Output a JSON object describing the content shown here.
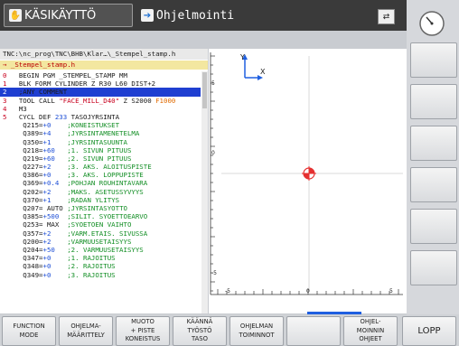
{
  "top": {
    "mode_manual": "KÄSIKÄYTTÖ",
    "mode_programming": "Ohjelmointi",
    "split_icon": "split-screen-icon"
  },
  "program": {
    "path": "TNC:\\nc_prog\\TNC\\BHB\\Klar…\\_Stempel_stamp.h",
    "file": "→ _Stempel_stamp.h",
    "lines": [
      {
        "n": "0",
        "parts": [
          {
            "t": "BEGIN PGM _STEMPEL_STAMP MM",
            "c": "kw"
          }
        ]
      },
      {
        "n": "1",
        "parts": [
          {
            "t": "BLK FORM CYLINDER Z R30 L60 DIST+2",
            "c": "kw"
          }
        ]
      },
      {
        "n": "2",
        "sel": true,
        "parts": [
          {
            "t": ";ANY COMMENT",
            "c": "kw"
          }
        ]
      },
      {
        "n": "3",
        "parts": [
          {
            "t": "TOOL CALL ",
            "c": "kw"
          },
          {
            "t": "\"FACE_MILL_D40\"",
            "c": "str"
          },
          {
            "t": " Z S2000 ",
            "c": "kw"
          },
          {
            "t": "F1000",
            "c": "hi"
          }
        ]
      },
      {
        "n": "4",
        "parts": [
          {
            "t": "M3",
            "c": "kw"
          }
        ]
      },
      {
        "n": "5",
        "parts": [
          {
            "t": "CYCL DEF ",
            "c": "kw"
          },
          {
            "t": "233",
            "c": "val"
          },
          {
            "t": " TASOJYRSINTA",
            "c": "kw"
          }
        ]
      },
      {
        "n": "",
        "parts": [
          {
            "t": "  Q215=",
            "c": "kw"
          },
          {
            "t": "+0   ",
            "c": "val"
          },
          {
            "t": " ;KONEISTUKSET",
            "c": "cmt"
          }
        ]
      },
      {
        "n": "",
        "parts": [
          {
            "t": "  Q389=",
            "c": "kw"
          },
          {
            "t": "+4   ",
            "c": "val"
          },
          {
            "t": " ;JYRSINTAMENETELMA",
            "c": "cmt"
          }
        ]
      },
      {
        "n": "",
        "parts": [
          {
            "t": "  Q350=",
            "c": "kw"
          },
          {
            "t": "+1   ",
            "c": "val"
          },
          {
            "t": " ;JYRSINTASUUNTA",
            "c": "cmt"
          }
        ]
      },
      {
        "n": "",
        "parts": [
          {
            "t": "  Q218=",
            "c": "kw"
          },
          {
            "t": "+60  ",
            "c": "val"
          },
          {
            "t": " ;1. SIVUN PITUUS",
            "c": "cmt"
          }
        ]
      },
      {
        "n": "",
        "parts": [
          {
            "t": "  Q219=",
            "c": "kw"
          },
          {
            "t": "+60  ",
            "c": "val"
          },
          {
            "t": " ;2. SIVUN PITUUS",
            "c": "cmt"
          }
        ]
      },
      {
        "n": "",
        "parts": [
          {
            "t": "  Q227=",
            "c": "kw"
          },
          {
            "t": "+2   ",
            "c": "val"
          },
          {
            "t": " ;3. AKS. ALOITUSPISTE",
            "c": "cmt"
          }
        ]
      },
      {
        "n": "",
        "parts": [
          {
            "t": "  Q386=",
            "c": "kw"
          },
          {
            "t": "+0   ",
            "c": "val"
          },
          {
            "t": " ;3. AKS. LOPPUPISTE",
            "c": "cmt"
          }
        ]
      },
      {
        "n": "",
        "parts": [
          {
            "t": "  Q369=",
            "c": "kw"
          },
          {
            "t": "+0.4 ",
            "c": "val"
          },
          {
            "t": " ;POHJAN ROUHINTAVARA",
            "c": "cmt"
          }
        ]
      },
      {
        "n": "",
        "parts": [
          {
            "t": "  Q202=",
            "c": "kw"
          },
          {
            "t": "+2   ",
            "c": "val"
          },
          {
            "t": " ;MAKS. ASETUSSYVYYS",
            "c": "cmt"
          }
        ]
      },
      {
        "n": "",
        "parts": [
          {
            "t": "  Q370=",
            "c": "kw"
          },
          {
            "t": "+1   ",
            "c": "val"
          },
          {
            "t": " ;RADAN YLITYS",
            "c": "cmt"
          }
        ]
      },
      {
        "n": "",
        "parts": [
          {
            "t": "  Q207= AUTO ",
            "c": "kw"
          },
          {
            "t": ";JYRSINTASYOTTO",
            "c": "cmt"
          }
        ]
      },
      {
        "n": "",
        "parts": [
          {
            "t": "  Q385=",
            "c": "kw"
          },
          {
            "t": "+500 ",
            "c": "val"
          },
          {
            "t": " ;SILIT. SYOETTOEARVO",
            "c": "cmt"
          }
        ]
      },
      {
        "n": "",
        "parts": [
          {
            "t": "  Q253= MAX  ",
            "c": "kw"
          },
          {
            "t": ";SYOETOEN VAIHTO",
            "c": "cmt"
          }
        ]
      },
      {
        "n": "",
        "parts": [
          {
            "t": "  Q357=",
            "c": "kw"
          },
          {
            "t": "+2   ",
            "c": "val"
          },
          {
            "t": " ;VARM.ETAIS. SIVUSSA",
            "c": "cmt"
          }
        ]
      },
      {
        "n": "",
        "parts": [
          {
            "t": "  Q200=",
            "c": "kw"
          },
          {
            "t": "+2   ",
            "c": "val"
          },
          {
            "t": " ;VARMUUSETAISYYS",
            "c": "cmt"
          }
        ]
      },
      {
        "n": "",
        "parts": [
          {
            "t": "  Q204=",
            "c": "kw"
          },
          {
            "t": "+50  ",
            "c": "val"
          },
          {
            "t": " ;2. VARMUUSETAISYYS",
            "c": "cmt"
          }
        ]
      },
      {
        "n": "",
        "parts": [
          {
            "t": "  Q347=",
            "c": "kw"
          },
          {
            "t": "+0   ",
            "c": "val"
          },
          {
            "t": " ;1. RAJOITUS",
            "c": "cmt"
          }
        ]
      },
      {
        "n": "",
        "parts": [
          {
            "t": "  Q348=",
            "c": "kw"
          },
          {
            "t": "+0   ",
            "c": "val"
          },
          {
            "t": " ;2. RAJOITUS",
            "c": "cmt"
          }
        ]
      },
      {
        "n": "",
        "parts": [
          {
            "t": "  Q349=",
            "c": "kw"
          },
          {
            "t": "+0   ",
            "c": "val"
          },
          {
            "t": " ;3. RAJOITUS",
            "c": "cmt"
          }
        ]
      }
    ]
  },
  "graphics": {
    "axis_y": "Y",
    "axis_x": "X",
    "ruler_left_labels": [
      "5",
      "0",
      "-5"
    ],
    "ruler_bottom_labels": [
      "-5",
      "0",
      "5"
    ],
    "datum_icon": "workpiece-origin-icon"
  },
  "softkeys": [
    {
      "l1": "FUNCTION",
      "l2": "MODE"
    },
    {
      "l1": "OHJELMA-",
      "l2": "MÄÄRITTELY"
    },
    {
      "l1": "MUOTO",
      "l2": "+ PISTE",
      "l3": "KONEISTUS"
    },
    {
      "l1": "KÄÄNNÄ",
      "l2": "TYÖSTÖ",
      "l3": "TASO"
    },
    {
      "l1": "OHJELMAN",
      "l2": "TOIMINNOT"
    },
    {
      "l1": ""
    },
    {
      "l1": "OHJEL-",
      "l2": "MOINNIN",
      "l3": "OHJEET"
    },
    {
      "l1": "LOPP"
    }
  ],
  "right_icon": "machine-status-gauge-icon"
}
